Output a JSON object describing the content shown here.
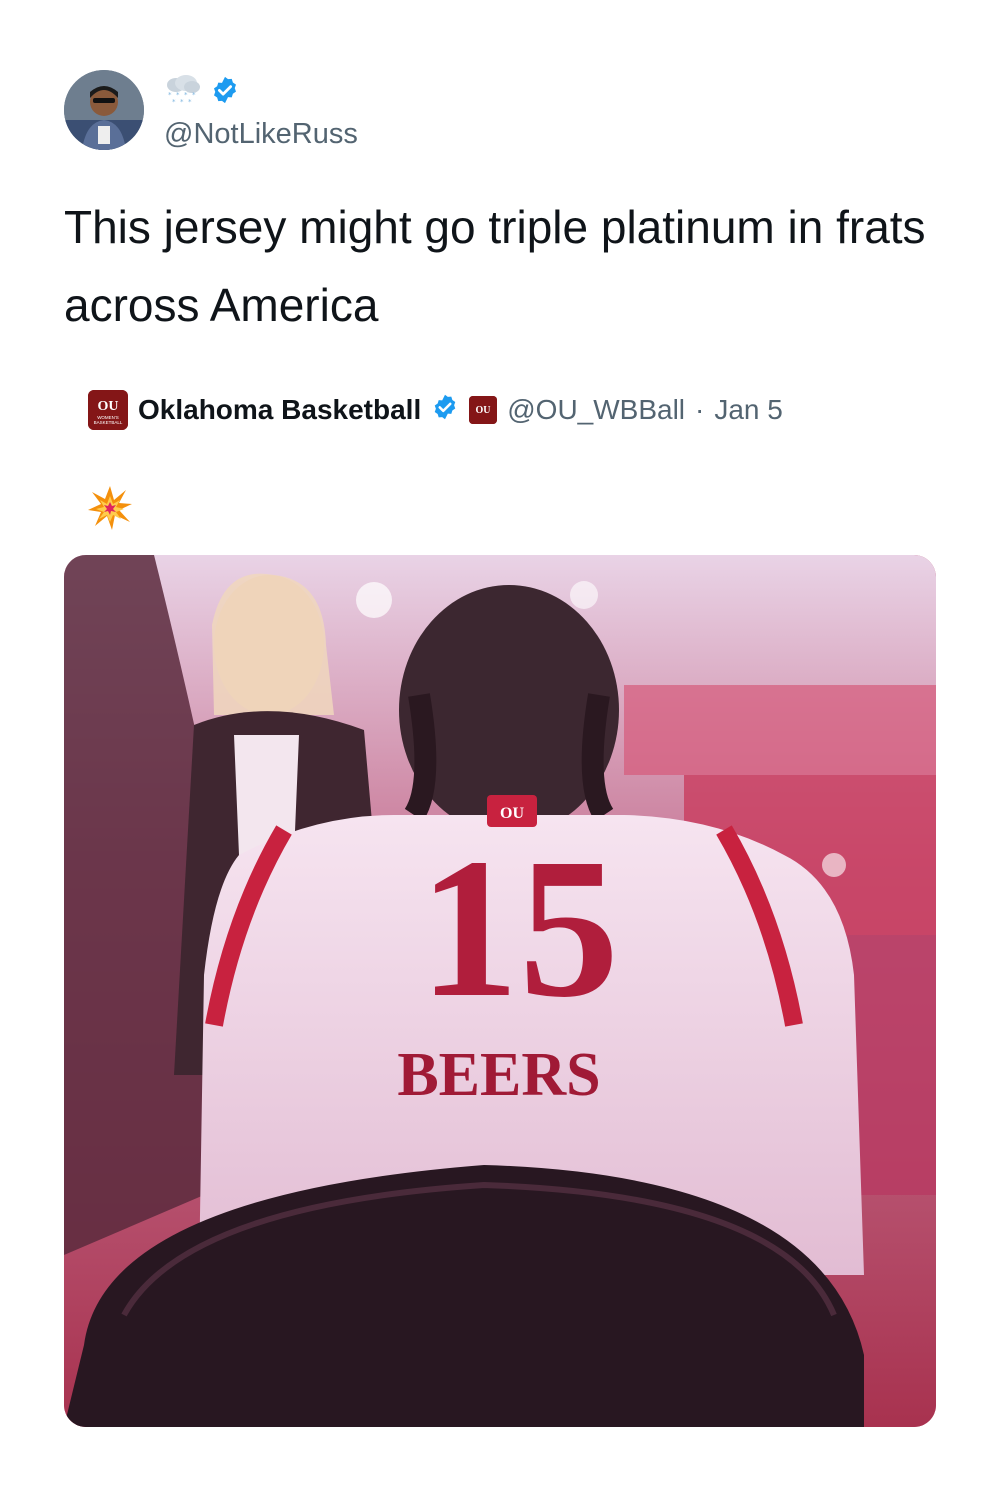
{
  "tweet": {
    "display_name_emoji": "snow-cloud-icon",
    "handle": "@NotLikeRuss",
    "text": "This jersey might go triple platinum in frats across America"
  },
  "quoted_tweet": {
    "name": "Oklahoma Basketball",
    "handle": "@OU_WBBall",
    "separator": "·",
    "date": "Jan 5",
    "logo_lettering": "OU WOMEN'S BASKETBALL",
    "emoji": "collision-icon",
    "image": {
      "jersey_number": "15",
      "jersey_name": "BEERS"
    }
  },
  "colors": {
    "verified": "#1d9bf0",
    "ou_crimson": "#841617",
    "secondary_text": "#536471"
  }
}
